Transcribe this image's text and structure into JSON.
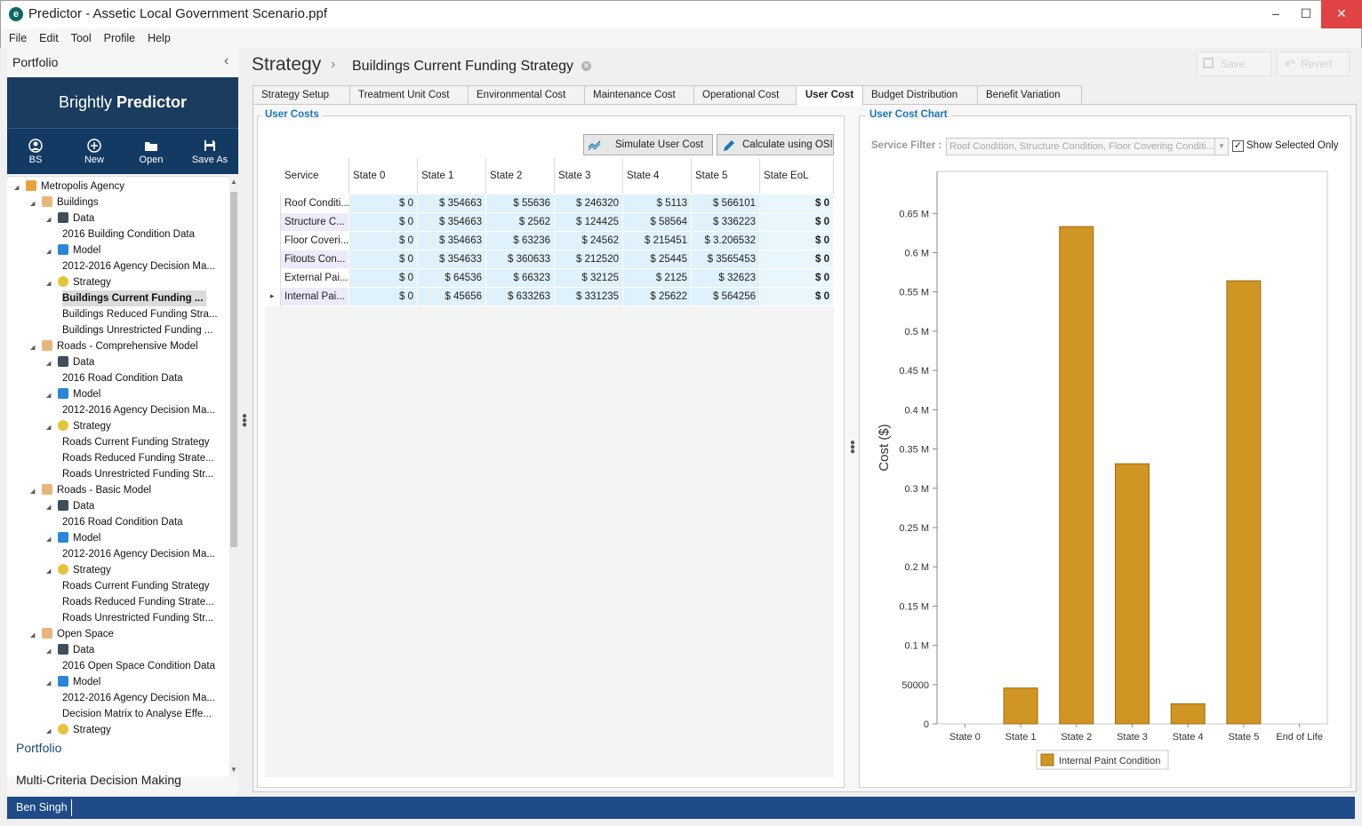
{
  "window": {
    "title": "Predictor - Assetic Local Government Scenario.ppf",
    "minimize": "–",
    "maximize": "☐",
    "close": "✕"
  },
  "menu": [
    "File",
    "Edit",
    "Tool",
    "Profile",
    "Help"
  ],
  "sidebar": {
    "title": "Portfolio",
    "collapse": "‹",
    "brand_prefix": "Brightly ",
    "brand_name": "Predictor",
    "toolbar": [
      {
        "label": "BS",
        "icon": "user-icon"
      },
      {
        "label": "New",
        "icon": "plus-circle-icon"
      },
      {
        "label": "Open",
        "icon": "folder-icon"
      },
      {
        "label": "Save As",
        "icon": "save-icon"
      }
    ],
    "tree": [
      {
        "label": "Metropolis Agency",
        "depth": 0,
        "icon": "agency",
        "expanded": true
      },
      {
        "label": "Buildings",
        "depth": 1,
        "icon": "portfolio",
        "expanded": true
      },
      {
        "label": "Data",
        "depth": 2,
        "icon": "data",
        "expanded": true
      },
      {
        "label": "2016 Building Condition Data",
        "depth": 3
      },
      {
        "label": "Model",
        "depth": 2,
        "icon": "model",
        "expanded": true
      },
      {
        "label": "2012-2016 Agency Decision Ma...",
        "depth": 3
      },
      {
        "label": "Strategy",
        "depth": 2,
        "icon": "strategy",
        "expanded": true
      },
      {
        "label": "Buildings Current Funding ...",
        "depth": 3,
        "selected": true
      },
      {
        "label": "Buildings Reduced Funding Stra...",
        "depth": 3
      },
      {
        "label": "Buildings Unrestricted Funding ...",
        "depth": 3
      },
      {
        "label": "Roads - Comprehensive Model",
        "depth": 1,
        "icon": "portfolio",
        "expanded": true
      },
      {
        "label": "Data",
        "depth": 2,
        "icon": "data",
        "expanded": true
      },
      {
        "label": "2016 Road Condition Data",
        "depth": 3
      },
      {
        "label": "Model",
        "depth": 2,
        "icon": "model",
        "expanded": true
      },
      {
        "label": "2012-2016 Agency Decision Ma...",
        "depth": 3
      },
      {
        "label": "Strategy",
        "depth": 2,
        "icon": "strategy",
        "expanded": true
      },
      {
        "label": "Roads Current Funding Strategy",
        "depth": 3
      },
      {
        "label": "Roads Reduced Funding Strate...",
        "depth": 3
      },
      {
        "label": "Roads Unrestricted Funding Str...",
        "depth": 3
      },
      {
        "label": "Roads - Basic Model",
        "depth": 1,
        "icon": "portfolio",
        "expanded": true
      },
      {
        "label": "Data",
        "depth": 2,
        "icon": "data",
        "expanded": true
      },
      {
        "label": "2016 Road Condition Data",
        "depth": 3
      },
      {
        "label": "Model",
        "depth": 2,
        "icon": "model",
        "expanded": true
      },
      {
        "label": "2012-2016 Agency Decision Ma...",
        "depth": 3
      },
      {
        "label": "Strategy",
        "depth": 2,
        "icon": "strategy",
        "expanded": true
      },
      {
        "label": "Roads Current Funding Strategy",
        "depth": 3
      },
      {
        "label": "Roads Reduced Funding Strate...",
        "depth": 3
      },
      {
        "label": "Roads Unrestricted Funding Str...",
        "depth": 3
      },
      {
        "label": "Open Space",
        "depth": 1,
        "icon": "portfolio",
        "expanded": true
      },
      {
        "label": "Data",
        "depth": 2,
        "icon": "data",
        "expanded": true
      },
      {
        "label": "2016 Open Space Condition Data",
        "depth": 3
      },
      {
        "label": "Model",
        "depth": 2,
        "icon": "model",
        "expanded": true
      },
      {
        "label": "2012-2016 Agency Decision Ma...",
        "depth": 3
      },
      {
        "label": "Decision Matrix to Analyse Effe...",
        "depth": 3
      },
      {
        "label": "Strategy",
        "depth": 2,
        "icon": "strategy",
        "expanded": true
      }
    ],
    "nav": [
      "Portfolio",
      "Multi-Criteria Decision Making"
    ]
  },
  "status": {
    "user": "Ben Singh"
  },
  "header": {
    "root": "Strategy",
    "separator": "›",
    "page": "Buildings Current Funding Strategy",
    "save": "Save",
    "revert": "Revert"
  },
  "tabs": [
    {
      "label": "Strategy Setup"
    },
    {
      "label": "Treatment Unit Cost"
    },
    {
      "label": "Environmental Cost"
    },
    {
      "label": "Maintenance Cost"
    },
    {
      "label": "Operational Cost"
    },
    {
      "label": "User Cost",
      "active": true
    },
    {
      "label": "Budget Distribution"
    },
    {
      "label": "Benefit Variation"
    }
  ],
  "user_costs": {
    "title": "User Costs",
    "simulate": "Simulate User Cost",
    "calculate": "Calculate using OSI",
    "columns": [
      "Service Name",
      "State 0",
      "State 1",
      "State 2",
      "State 3",
      "State 4",
      "State 5",
      "State EoL"
    ],
    "rows": [
      [
        "Roof Conditi...",
        "$ 0",
        "$ 354663",
        "$ 55636",
        "$ 246320",
        "$ 5113",
        "$ 566101",
        "$ 0"
      ],
      [
        "Structure C...",
        "$ 0",
        "$ 354663",
        "$ 2562",
        "$ 124425",
        "$ 58564",
        "$ 336223",
        "$ 0"
      ],
      [
        "Floor Coveri...",
        "$ 0",
        "$ 354663",
        "$ 63236",
        "$ 24562",
        "$ 215451",
        "$ 3.206532",
        "$ 0"
      ],
      [
        "Fitouts Con...",
        "$ 0",
        "$ 354633",
        "$ 360633",
        "$ 212520",
        "$ 25445",
        "$ 3565453",
        "$ 0"
      ],
      [
        "External Pai...",
        "$ 0",
        "$ 64536",
        "$ 66323",
        "$ 32125",
        "$ 2125",
        "$ 32623",
        "$ 0"
      ],
      [
        "Internal Pai...",
        "$ 0",
        "$ 45656",
        "$ 633263",
        "$ 331235",
        "$ 25622",
        "$ 564256",
        "$ 0"
      ]
    ],
    "current_row_marker": "▸"
  },
  "chart_panel": {
    "title": "User Cost Chart",
    "filter_label": "Service Filter :",
    "filter_value": "Roof Condition, Structure Condition, Floor Covering Conditi...",
    "show_selected": "Show Selected Only",
    "show_selected_checked": "✓"
  },
  "chart_data": {
    "type": "bar",
    "categories": [
      "State 0",
      "State 1",
      "State 2",
      "State 3",
      "State 4",
      "State 5",
      "End of Life"
    ],
    "series": [
      {
        "name": "Internal Paint Condition",
        "values": [
          0,
          45656,
          633263,
          331235,
          25622,
          564256,
          0
        ],
        "color": "#d09522"
      }
    ],
    "ylabel": "Cost ($)",
    "ylim": [
      0,
      700000
    ],
    "yticks": [
      0,
      50000,
      100000,
      150000,
      200000,
      250000,
      300000,
      350000,
      400000,
      450000,
      500000,
      550000,
      600000,
      650000
    ],
    "ytick_labels": [
      "0",
      "50000",
      "0.1 M",
      "0.15 M",
      "0.2 M",
      "0.25 M",
      "0.3 M",
      "0.35 M",
      "0.4 M",
      "0.45 M",
      "0.5 M",
      "0.55 M",
      "0.6 M",
      "0.65 M"
    ],
    "legend": "bottom-center",
    "grid": false
  }
}
